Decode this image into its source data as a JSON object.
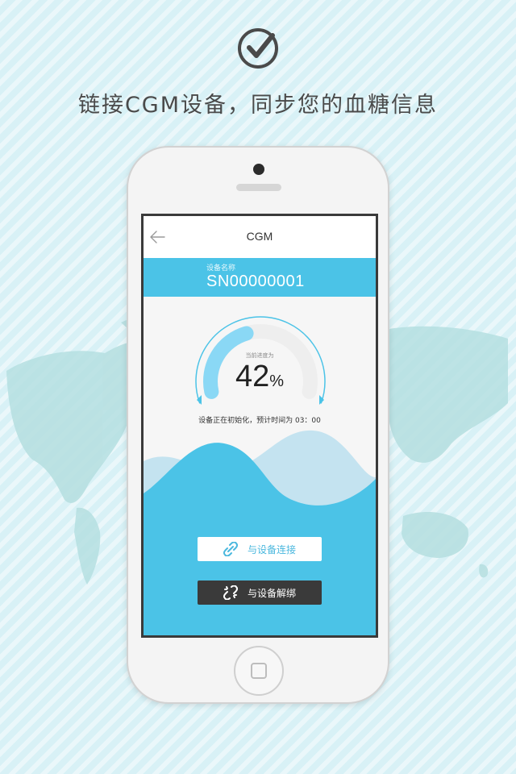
{
  "headline": "链接CGM设备，同步您的血糖信息",
  "icons": {
    "top": "checkmark-circle-icon",
    "back": "back-arrow-icon",
    "connect": "link-icon",
    "unbind": "unlink-icon"
  },
  "screen": {
    "nav_title": "CGM",
    "device_name_label": "设备名称",
    "device_sn": "SN00000001",
    "progress_caption": "当前进度为",
    "progress_value": "42",
    "progress_unit": "%",
    "progress_fraction": 0.42,
    "status_text": "设备正在初始化，预计时间为 03：00",
    "connect_button_label": "与设备连接",
    "unbind_button_label": "与设备解绑"
  },
  "colors": {
    "accent": "#4bc3e7",
    "wave_light": "#c4e3f0",
    "gauge_fill": "#8ad8f5",
    "background": "#d8f1f6",
    "dark_button": "#3a3a3a"
  }
}
